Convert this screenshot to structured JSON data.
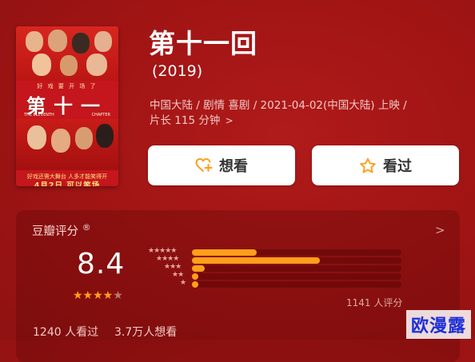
{
  "movie": {
    "title": "第十一回",
    "year": "(2019)",
    "meta_line1": "中国大陆 / 剧情 喜剧 / 2021-04-02(中国大陆) 上映 /",
    "meta_line2": "片长 115 分钟",
    "meta_chevron": ">"
  },
  "poster": {
    "subtitle": "好 戏 要 开 场 了",
    "title": "第十一回",
    "eng_left": "THE ELEVENTH",
    "eng_right": "CHAPTER",
    "tagline": "好戏还需大舞台 人多才能笑得开",
    "date": "4月2日 可以笑场"
  },
  "buttons": {
    "want_label": "想看",
    "seen_label": "看过"
  },
  "rating": {
    "source_label": "豆瓣评分",
    "registered_mark": "®",
    "chevron": ">",
    "score": "8.4",
    "stars_on": "★★★★",
    "stars_off": "★",
    "star_fraction": 0.84,
    "distribution": [
      {
        "stars": "★★★★★",
        "percent": 31
      },
      {
        "stars": "★★★★",
        "percent": 61
      },
      {
        "stars": "★★★",
        "percent": 6
      },
      {
        "stars": "★★",
        "percent": 1
      },
      {
        "stars": "★",
        "percent": 1
      }
    ],
    "count_text": "1141 人评分"
  },
  "stats": {
    "watched": "1240 人看过",
    "want": "3.7万人想看"
  },
  "watermark": "欧漫露",
  "colors": {
    "background": "#9e1414",
    "accent": "#ff9f1a",
    "button_bg": "#ffffff"
  }
}
